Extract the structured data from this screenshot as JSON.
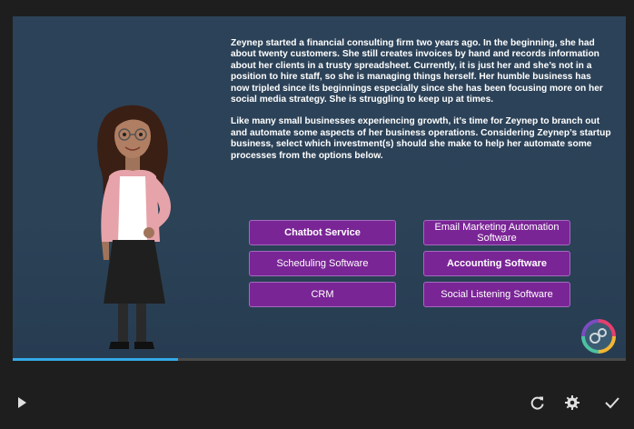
{
  "scenario": {
    "paragraph1": "Zeynep started a financial consulting firm two years ago. In the beginning, she had about twenty customers. She still creates invoices by hand and records information about her clients in a trusty spreadsheet. Currently, it is just her and she’s not in a position to hire staff, so she is managing things herself. Her humble business has now tripled since its beginnings especially since she has been focusing more on her social media strategy. She is struggling to keep up at times.",
    "paragraph2": " Like many small businesses experiencing growth, it’s time for Zeynep to branch out and automate some aspects of her business operations. Considering Zeynep’s startup business, select which investment(s) should she make to help her automate some processes from the options below."
  },
  "options": {
    "chatbot": "Chatbot Service",
    "email_marketing": "Email Marketing Automation Software",
    "scheduling": "Scheduling Software",
    "accounting": "Accounting Software",
    "crm": "CRM",
    "social_listening": "Social Listening Software"
  },
  "progress": {
    "fraction": 0.27
  },
  "controls": {
    "play_icon": "play-icon",
    "replay_icon": "replay-icon",
    "settings_icon": "gear-icon",
    "submit_icon": "checkmark-icon"
  },
  "colors": {
    "stage_bg": "#2c4258",
    "option_bg": "#7a2596",
    "progress": "#35a9e6"
  }
}
